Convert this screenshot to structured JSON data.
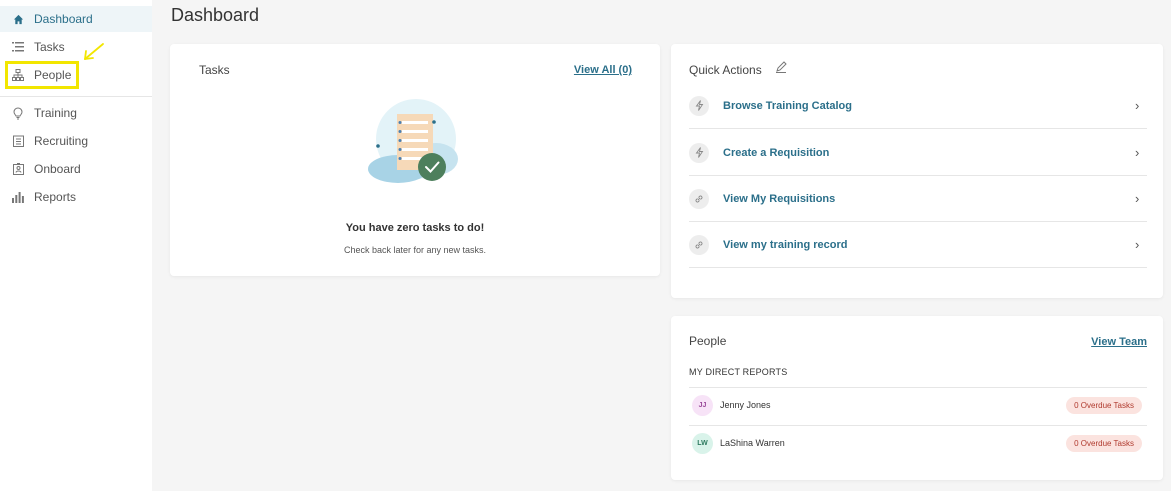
{
  "sidebar": {
    "items": [
      {
        "label": "Dashboard",
        "icon": "home-icon"
      },
      {
        "label": "Tasks",
        "icon": "list-icon"
      },
      {
        "label": "People",
        "icon": "org-chart-icon"
      },
      {
        "label": "Training",
        "icon": "lightbulb-icon"
      },
      {
        "label": "Recruiting",
        "icon": "clipboard-icon"
      },
      {
        "label": "Onboard",
        "icon": "badge-icon"
      },
      {
        "label": "Reports",
        "icon": "bar-chart-icon"
      }
    ],
    "active_item": "Dashboard",
    "annotation_color": "#f2e600"
  },
  "page": {
    "title": "Dashboard"
  },
  "tasks_card": {
    "title": "Tasks",
    "view_all": "View All (0)",
    "empty_title": "You have zero tasks to do!",
    "empty_subtitle": "Check back later for any new tasks."
  },
  "quick_actions": {
    "title": "Quick Actions",
    "items": [
      {
        "label": "Browse Training Catalog",
        "icon": "lightning-icon"
      },
      {
        "label": "Create a Requisition",
        "icon": "lightning-icon"
      },
      {
        "label": "View My Requisitions",
        "icon": "link-icon"
      },
      {
        "label": "View my training record",
        "icon": "link-icon"
      }
    ]
  },
  "people_card": {
    "title": "People",
    "view_team": "View Team",
    "subheading": "MY DIRECT REPORTS",
    "reports": [
      {
        "initials": "JJ",
        "name": "Jenny Jones",
        "badge": "0 Overdue Tasks",
        "avatar_bg": "#f7e3f7",
        "avatar_fg": "#9a4a9a"
      },
      {
        "initials": "LW",
        "name": "LaShina Warren",
        "badge": "0 Overdue Tasks",
        "avatar_bg": "#d9f3ea",
        "avatar_fg": "#2d7a5f"
      }
    ]
  },
  "colors": {
    "accent": "#2b6f8a",
    "badge_text": "#b03a2e",
    "badge_bg": "#fbe3df"
  }
}
